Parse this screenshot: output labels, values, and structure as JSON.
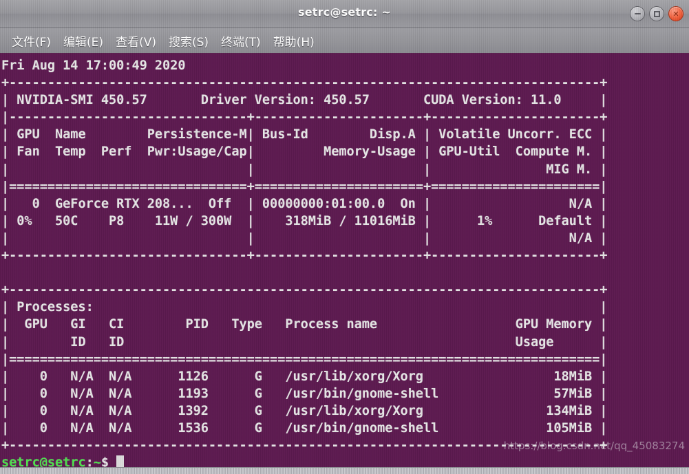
{
  "window": {
    "title": "setrc@setrc: ~",
    "controls": [
      {
        "name": "minimize",
        "glyph": "—"
      },
      {
        "name": "maximize",
        "glyph": "□"
      },
      {
        "name": "close",
        "glyph": "✕"
      }
    ]
  },
  "menubar": {
    "items": [
      {
        "label": "文件(F)",
        "name": "menu-file"
      },
      {
        "label": "编辑(E)",
        "name": "menu-edit"
      },
      {
        "label": "查看(V)",
        "name": "menu-view"
      },
      {
        "label": "搜索(S)",
        "name": "menu-search"
      },
      {
        "label": "终端(T)",
        "name": "menu-terminal"
      },
      {
        "label": "帮助(H)",
        "name": "menu-help"
      }
    ]
  },
  "terminal": {
    "colors": {
      "background": "#5d1a50",
      "foreground": "#e6e6e6",
      "prompt_user": "#4ee24e",
      "titlebar": "#97979c"
    },
    "timestamp": "Fri Aug 14 17:00:49 2020",
    "nvidia_smi": {
      "smi_version_label": "NVIDIA-SMI 450.57",
      "driver_version_label": "Driver Version: 450.57",
      "cuda_version_label": "CUDA Version: 11.0",
      "column_headers_line1": [
        "GPU",
        "Name",
        "Persistence-M",
        "Bus-Id",
        "Disp.A",
        "Volatile Uncorr. ECC"
      ],
      "column_headers_line2": [
        "Fan",
        "Temp",
        "Perf",
        "Pwr:Usage/Cap",
        "Memory-Usage",
        "GPU-Util",
        "Compute M."
      ],
      "column_headers_line3": [
        "MIG M."
      ],
      "gpus": [
        {
          "index": "0",
          "name": "GeForce RTX 208...",
          "persistence_m": "Off",
          "bus_id": "00000000:01:00.0",
          "disp_a": "On",
          "uncorr_ecc": "N/A",
          "fan": "0%",
          "temp": "50C",
          "perf": "P8",
          "pwr_usage_cap": "11W / 300W",
          "memory_usage": "318MiB / 11016MiB",
          "gpu_util": "1%",
          "compute_m": "Default",
          "mig_m": "N/A"
        }
      ],
      "processes_title": "Processes:",
      "process_headers_line1": [
        "GPU",
        "GI",
        "CI",
        "PID",
        "Type",
        "Process name",
        "GPU Memory"
      ],
      "process_headers_line2": [
        "ID",
        "ID",
        "Usage"
      ],
      "processes": [
        {
          "gpu": "0",
          "gi_id": "N/A",
          "ci_id": "N/A",
          "pid": "1126",
          "type": "G",
          "process_name": "/usr/lib/xorg/Xorg",
          "gpu_memory_usage": "18MiB"
        },
        {
          "gpu": "0",
          "gi_id": "N/A",
          "ci_id": "N/A",
          "pid": "1193",
          "type": "G",
          "process_name": "/usr/bin/gnome-shell",
          "gpu_memory_usage": "57MiB"
        },
        {
          "gpu": "0",
          "gi_id": "N/A",
          "ci_id": "N/A",
          "pid": "1392",
          "type": "G",
          "process_name": "/usr/lib/xorg/Xorg",
          "gpu_memory_usage": "134MiB"
        },
        {
          "gpu": "0",
          "gi_id": "N/A",
          "ci_id": "N/A",
          "pid": "1536",
          "type": "G",
          "process_name": "/usr/bin/gnome-shell",
          "gpu_memory_usage": "105MiB"
        }
      ]
    },
    "screen_text": "Fri Aug 14 17:00:49 2020\n+-----------------------------------------------------------------------------+\n| NVIDIA-SMI 450.57       Driver Version: 450.57       CUDA Version: 11.0     |\n|-------------------------------+----------------------+----------------------+\n| GPU  Name        Persistence-M| Bus-Id        Disp.A | Volatile Uncorr. ECC |\n| Fan  Temp  Perf  Pwr:Usage/Cap|         Memory-Usage | GPU-Util  Compute M. |\n|                               |                      |               MIG M. |\n|===============================+======================+======================|\n|   0  GeForce RTX 208...  Off  | 00000000:01:00.0  On |                  N/A |\n| 0%   50C    P8    11W / 300W  |    318MiB / 11016MiB |      1%      Default |\n|                               |                      |                  N/A |\n+-------------------------------+----------------------+----------------------+\n                                                                               \n+-----------------------------------------------------------------------------+\n| Processes:                                                                  |\n|  GPU   GI   CI        PID   Type   Process name                  GPU Memory |\n|        ID   ID                                                   Usage      |\n|=============================================================================|\n|    0   N/A  N/A      1126      G   /usr/lib/xorg/Xorg                 18MiB |\n|    0   N/A  N/A      1193      G   /usr/bin/gnome-shell               57MiB |\n|    0   N/A  N/A      1392      G   /usr/lib/xorg/Xorg                134MiB |\n|    0   N/A  N/A      1536      G   /usr/bin/gnome-shell              105MiB |\n+-----------------------------------------------------------------------------+",
    "prompt": {
      "user_host": "setrc@setrc",
      "separator": ":",
      "path": "~",
      "symbol": "$",
      "command": ""
    }
  },
  "watermark": {
    "text": "https://blog.csdn.net/qq_45083274"
  }
}
